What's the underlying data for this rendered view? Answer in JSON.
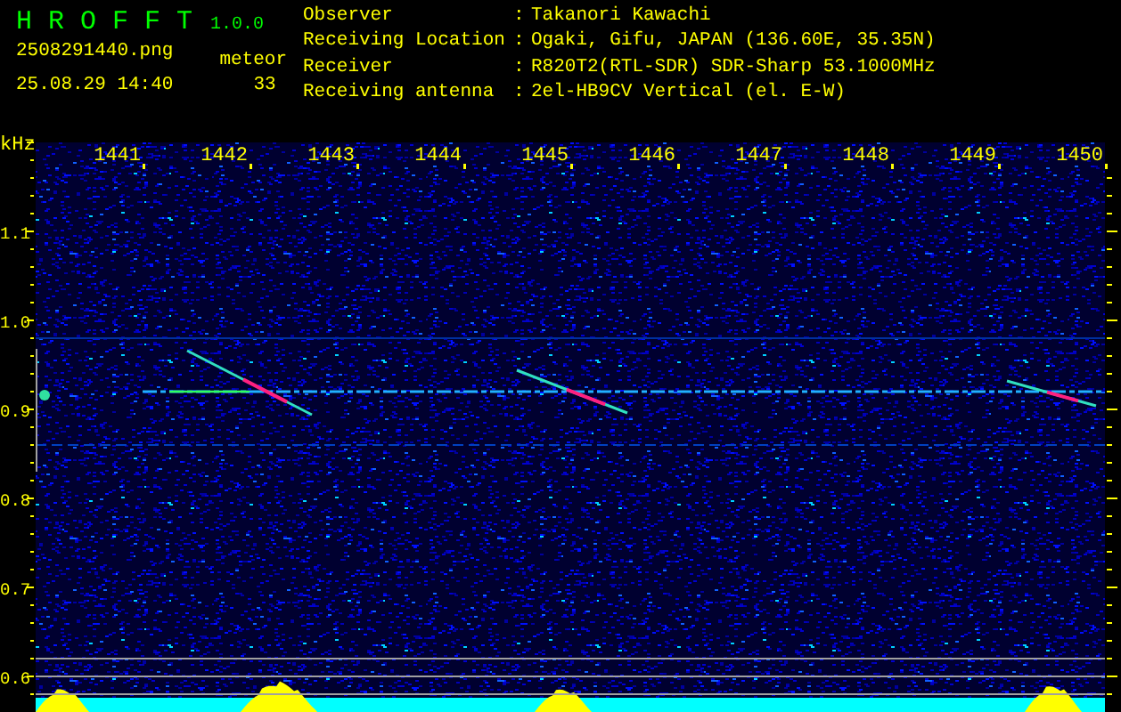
{
  "header": {
    "app_title": "H R O F F T",
    "version": "1.0.0",
    "file_name": "2508291440.png",
    "count_label": "meteor",
    "timestamp": "25.08.29 14:40",
    "count": "33"
  },
  "station_info": [
    {
      "label": "Observer",
      "separator": ":",
      "value": "Takanori Kawachi"
    },
    {
      "label": "Receiving Location",
      "separator": ":",
      "value": "Ogaki, Gifu, JAPAN (136.60E, 35.35N)"
    },
    {
      "label": "Receiver",
      "separator": ":",
      "value": "R820T2(RTL-SDR) SDR-Sharp 53.1000MHz"
    },
    {
      "label": "Receiving antenna",
      "separator": ":",
      "value": "2el-HB9CV Vertical (el. E-W)"
    }
  ],
  "plot": {
    "y_unit": "kHz",
    "x_labels": [
      "1441",
      "1442",
      "1443",
      "1444",
      "1445",
      "1446",
      "1447",
      "1448",
      "1449",
      "1450"
    ],
    "y_labels": [
      "1.1",
      "1.0",
      "0.9",
      "0.8",
      "0.7",
      "0.6"
    ]
  }
}
